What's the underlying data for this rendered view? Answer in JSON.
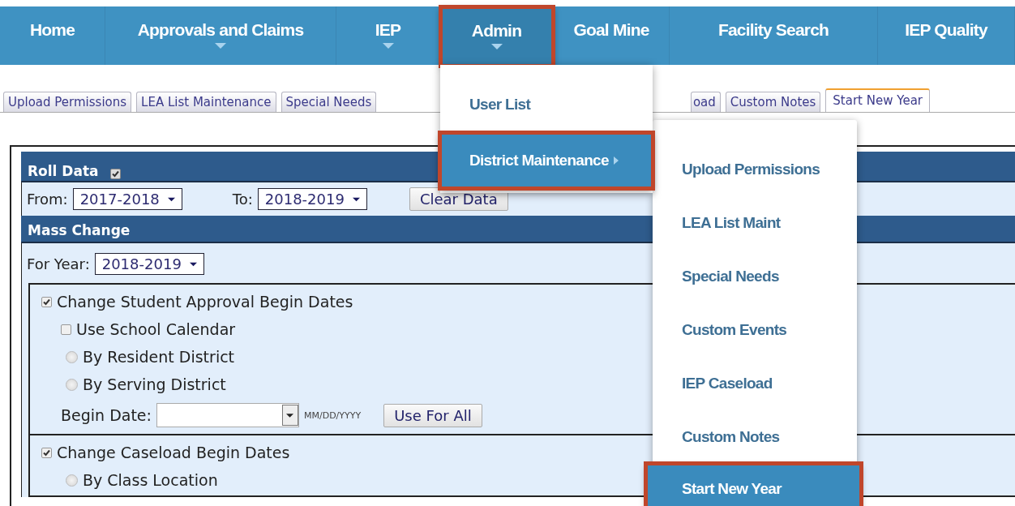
{
  "nav": [
    {
      "label": "Home",
      "has_caret": false,
      "highlighted": false
    },
    {
      "label": "Approvals and Claims",
      "has_caret": true,
      "highlighted": false
    },
    {
      "label": "IEP",
      "has_caret": true,
      "highlighted": false
    },
    {
      "label": "Admin",
      "has_caret": true,
      "highlighted": true
    },
    {
      "label": "Goal Mine",
      "has_caret": false,
      "highlighted": false
    },
    {
      "label": "Facility Search",
      "has_caret": false,
      "highlighted": false
    },
    {
      "label": "IEP Quality",
      "has_caret": false,
      "highlighted": false
    }
  ],
  "tabs": [
    {
      "label": "Upload Permissions",
      "selected": false,
      "kind": "full"
    },
    {
      "label": "LEA List Maintenance",
      "selected": false,
      "kind": "full"
    },
    {
      "label": "Special Needs",
      "selected": false,
      "kind": "full"
    },
    {
      "label": "oad",
      "selected": false,
      "kind": "partial"
    },
    {
      "label": "Custom Notes",
      "selected": false,
      "kind": "full"
    },
    {
      "label": "Start New Year",
      "selected": true,
      "kind": "full"
    }
  ],
  "admin_menu": {
    "items": [
      {
        "label": "User List",
        "highlighted": false,
        "has_submenu": false
      },
      {
        "label": "District Maintenance",
        "highlighted": true,
        "has_submenu": true
      }
    ]
  },
  "submenu": {
    "items": [
      {
        "label": "Upload Permissions",
        "highlighted": false
      },
      {
        "label": "LEA List Maint",
        "highlighted": false
      },
      {
        "label": "Special Needs",
        "highlighted": false
      },
      {
        "label": "Custom Events",
        "highlighted": false
      },
      {
        "label": "IEP Caseload",
        "highlighted": false
      },
      {
        "label": "Custom Notes",
        "highlighted": false
      },
      {
        "label": "Start New Year",
        "highlighted": true
      }
    ]
  },
  "roll_data": {
    "title": "Roll Data",
    "checked": true,
    "from_label": "From:",
    "from_value": "2017-2018",
    "to_label": "To:",
    "to_value": "2018-2019",
    "clear_button": "Clear Data"
  },
  "mass_change": {
    "title": "Mass Change",
    "year_label": "For Year:",
    "year_value": "2018-2019",
    "groups": [
      {
        "label": "Change Student Approval Begin Dates",
        "checked": true,
        "options": [
          {
            "kind": "checkbox",
            "label": "Use School Calendar",
            "checked": false
          },
          {
            "kind": "radio",
            "label": "By Resident District",
            "selected": false
          },
          {
            "kind": "radio",
            "label": "By Serving District",
            "selected": false
          }
        ],
        "date_label": "Begin Date:",
        "date_hint": "MM/DD/YYYY",
        "apply_button": "Use For All"
      },
      {
        "label": "Change Caseload Begin Dates",
        "checked": true,
        "options": [
          {
            "kind": "radio",
            "label": "By Class Location",
            "selected": false
          }
        ]
      }
    ]
  }
}
